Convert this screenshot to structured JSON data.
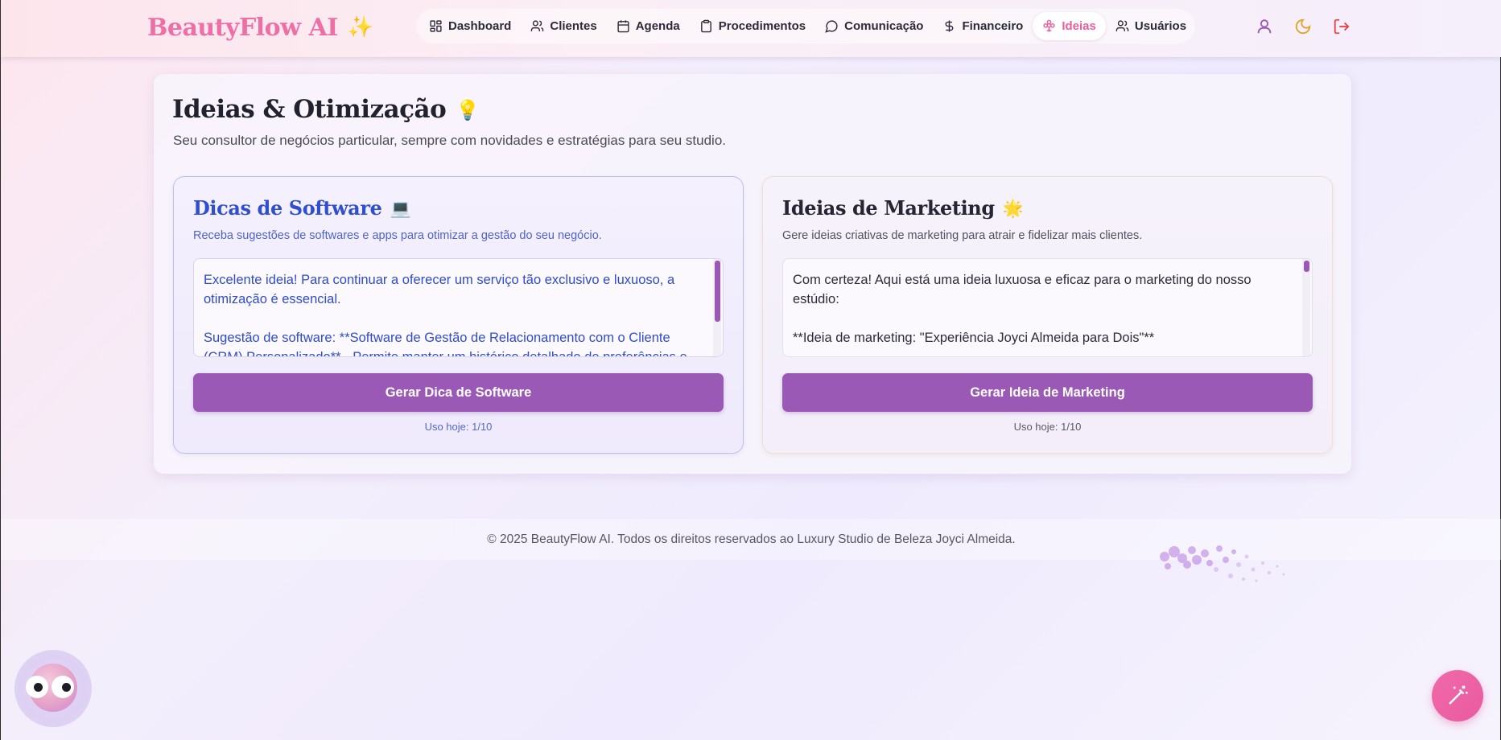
{
  "header": {
    "brand": "BeautyFlow AI",
    "brand_emoji": "✨",
    "nav": [
      {
        "label": "Dashboard",
        "icon": "grid-icon"
      },
      {
        "label": "Clientes",
        "icon": "users-icon"
      },
      {
        "label": "Agenda",
        "icon": "calendar-icon"
      },
      {
        "label": "Procedimentos",
        "icon": "clipboard-icon"
      },
      {
        "label": "Comunicação",
        "icon": "chat-bubble-icon"
      },
      {
        "label": "Financeiro",
        "icon": "dollar-icon"
      },
      {
        "label": "Ideias",
        "icon": "flower-icon",
        "active": true
      },
      {
        "label": "Usuários",
        "icon": "users-icon"
      }
    ],
    "actions": [
      {
        "icon": "user-icon",
        "color": "#9b59b6"
      },
      {
        "icon": "moon-icon",
        "color": "#e0a526"
      },
      {
        "icon": "logout-icon",
        "color": "#e24646"
      }
    ]
  },
  "page": {
    "title": "Ideias & Otimização",
    "title_emoji": "💡",
    "subtitle": "Seu consultor de negócios particular, sempre com novidades e estratégias para seu studio."
  },
  "software_panel": {
    "title": "Dicas de Software",
    "title_emoji": "💻",
    "description": "Receba sugestões de softwares e apps para otimizar a gestão do seu negócio.",
    "paragraphs": [
      "Excelente ideia! Para continuar a oferecer um serviço tão exclusivo e luxuoso, a otimização é essencial.",
      "Sugestão de software: **Software de Gestão de Relacionamento com o Cliente (CRM) Personalizado** - Permite manter um histórico detalhado de preferências e"
    ],
    "button": "Gerar Dica de Software",
    "usage": "Uso hoje: 1/10",
    "accent": "#2f4fd0"
  },
  "marketing_panel": {
    "title": "Ideias de Marketing",
    "title_emoji": "🌟",
    "description": "Gere ideias criativas de marketing para atrair e fidelizar mais clientes.",
    "paragraphs": [
      "Com certeza! Aqui está uma ideia luxuosa e eficaz para o marketing do nosso estúdio:",
      "**Ideia de marketing: \"Experiência Joyci Almeida para Dois\"**"
    ],
    "button": "Gerar Ideia de Marketing",
    "usage": "Uso hoje: 1/10"
  },
  "footer": {
    "text": "© 2025 BeautyFlow AI. Todos os direitos reservados ao Luxury Studio de Beleza Joyci Almeida."
  },
  "floating": {
    "mascot_icon": "mascot-eyes-icon",
    "magic_icon": "magic-wand-icon",
    "button_color": "#ec5d9a",
    "primary_color": "#9b59b6"
  }
}
